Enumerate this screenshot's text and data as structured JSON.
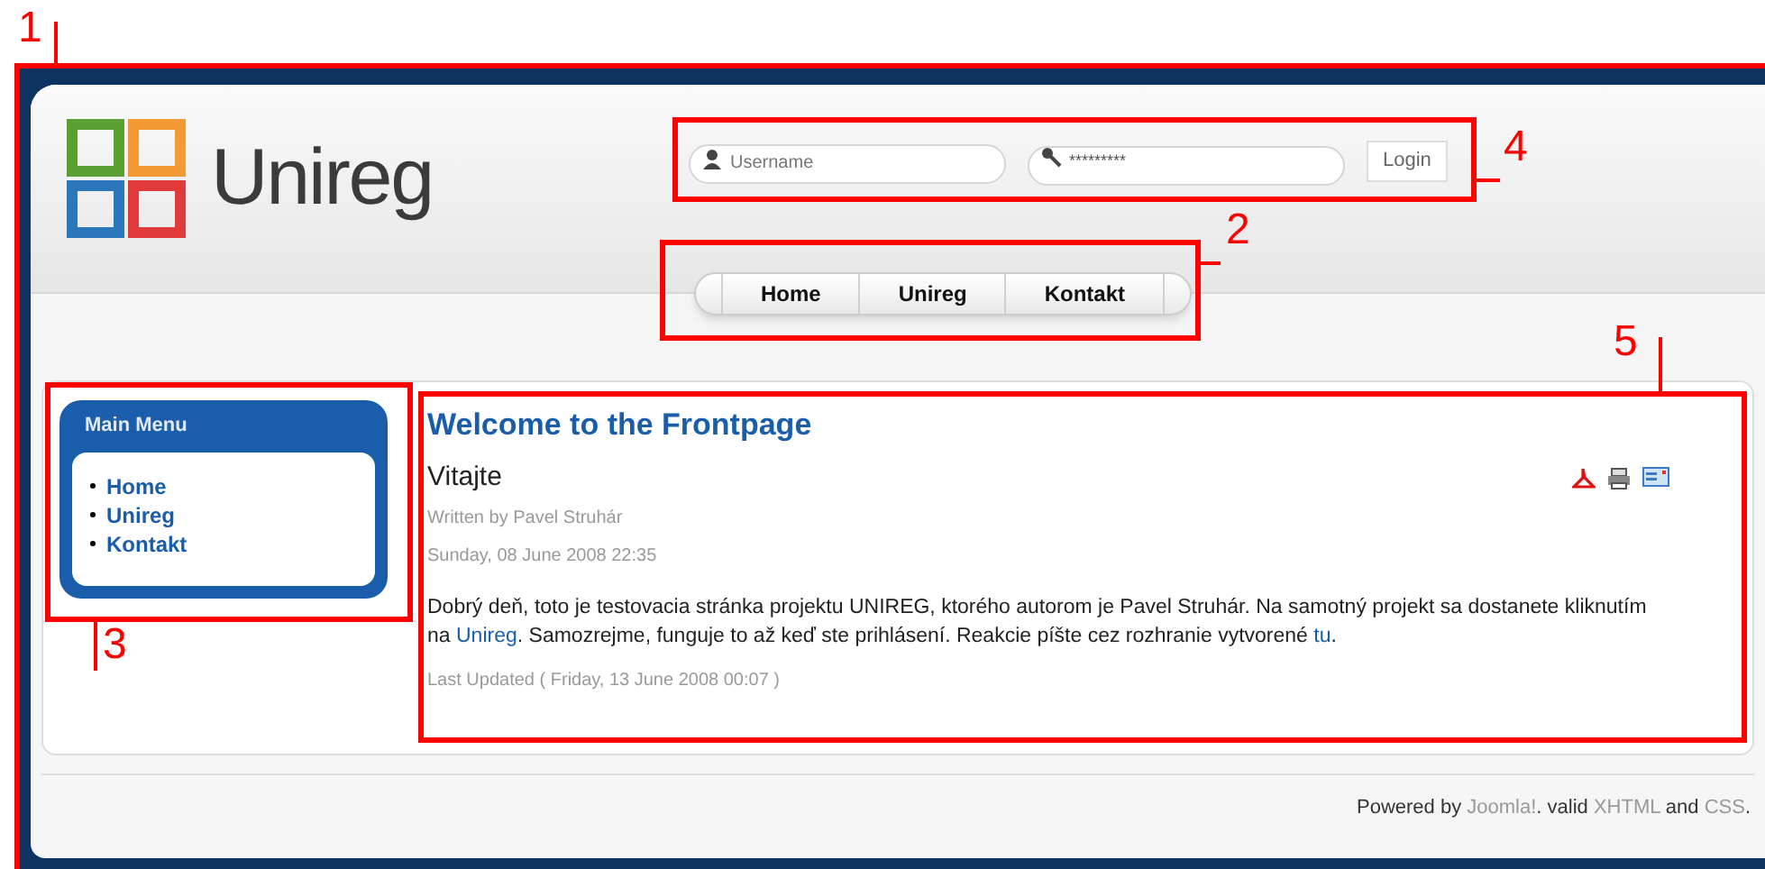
{
  "logo": {
    "text": "Unireg"
  },
  "login": {
    "username_placeholder": "Username",
    "password_value": "*********",
    "button": "Login"
  },
  "nav": [
    {
      "label": "Home"
    },
    {
      "label": "Unireg"
    },
    {
      "label": "Kontakt"
    }
  ],
  "main_menu": {
    "title": "Main Menu",
    "items": [
      {
        "label": "Home"
      },
      {
        "label": "Unireg"
      },
      {
        "label": "Kontakt"
      }
    ]
  },
  "article": {
    "page_title": "Welcome to the Frontpage",
    "title": "Vitajte",
    "author": "Written by Pavel Struhár",
    "date": "Sunday, 08 June 2008 22:35",
    "body": [
      {
        "text": "Dobrý deň, toto je testovacia stránka projektu UNIREG, ktorého autorom je Pavel Struhár. Na samotný projekt sa dostanete kliknutím na ",
        "link": false
      },
      {
        "text": "Unireg",
        "link": true
      },
      {
        "text": ". Samozrejme, funguje to až keď ste prihlásení. Reakcie píšte cez rozhranie vytvorené ",
        "link": false
      },
      {
        "text": "tu",
        "link": true
      },
      {
        "text": ".",
        "link": false
      }
    ],
    "last_updated": "Last Updated ( Friday, 13 June 2008 00:07 )"
  },
  "footer": [
    {
      "text": "Powered by ",
      "link": false
    },
    {
      "text": "Joomla!",
      "link": true
    },
    {
      "text": ". valid ",
      "link": false
    },
    {
      "text": "XHTML",
      "link": true
    },
    {
      "text": " and ",
      "link": false
    },
    {
      "text": "CSS",
      "link": true
    },
    {
      "text": ".",
      "link": false
    }
  ],
  "annotations": [
    {
      "label": "1"
    },
    {
      "label": "4"
    },
    {
      "label": "2"
    },
    {
      "label": "3"
    },
    {
      "label": "5"
    }
  ]
}
